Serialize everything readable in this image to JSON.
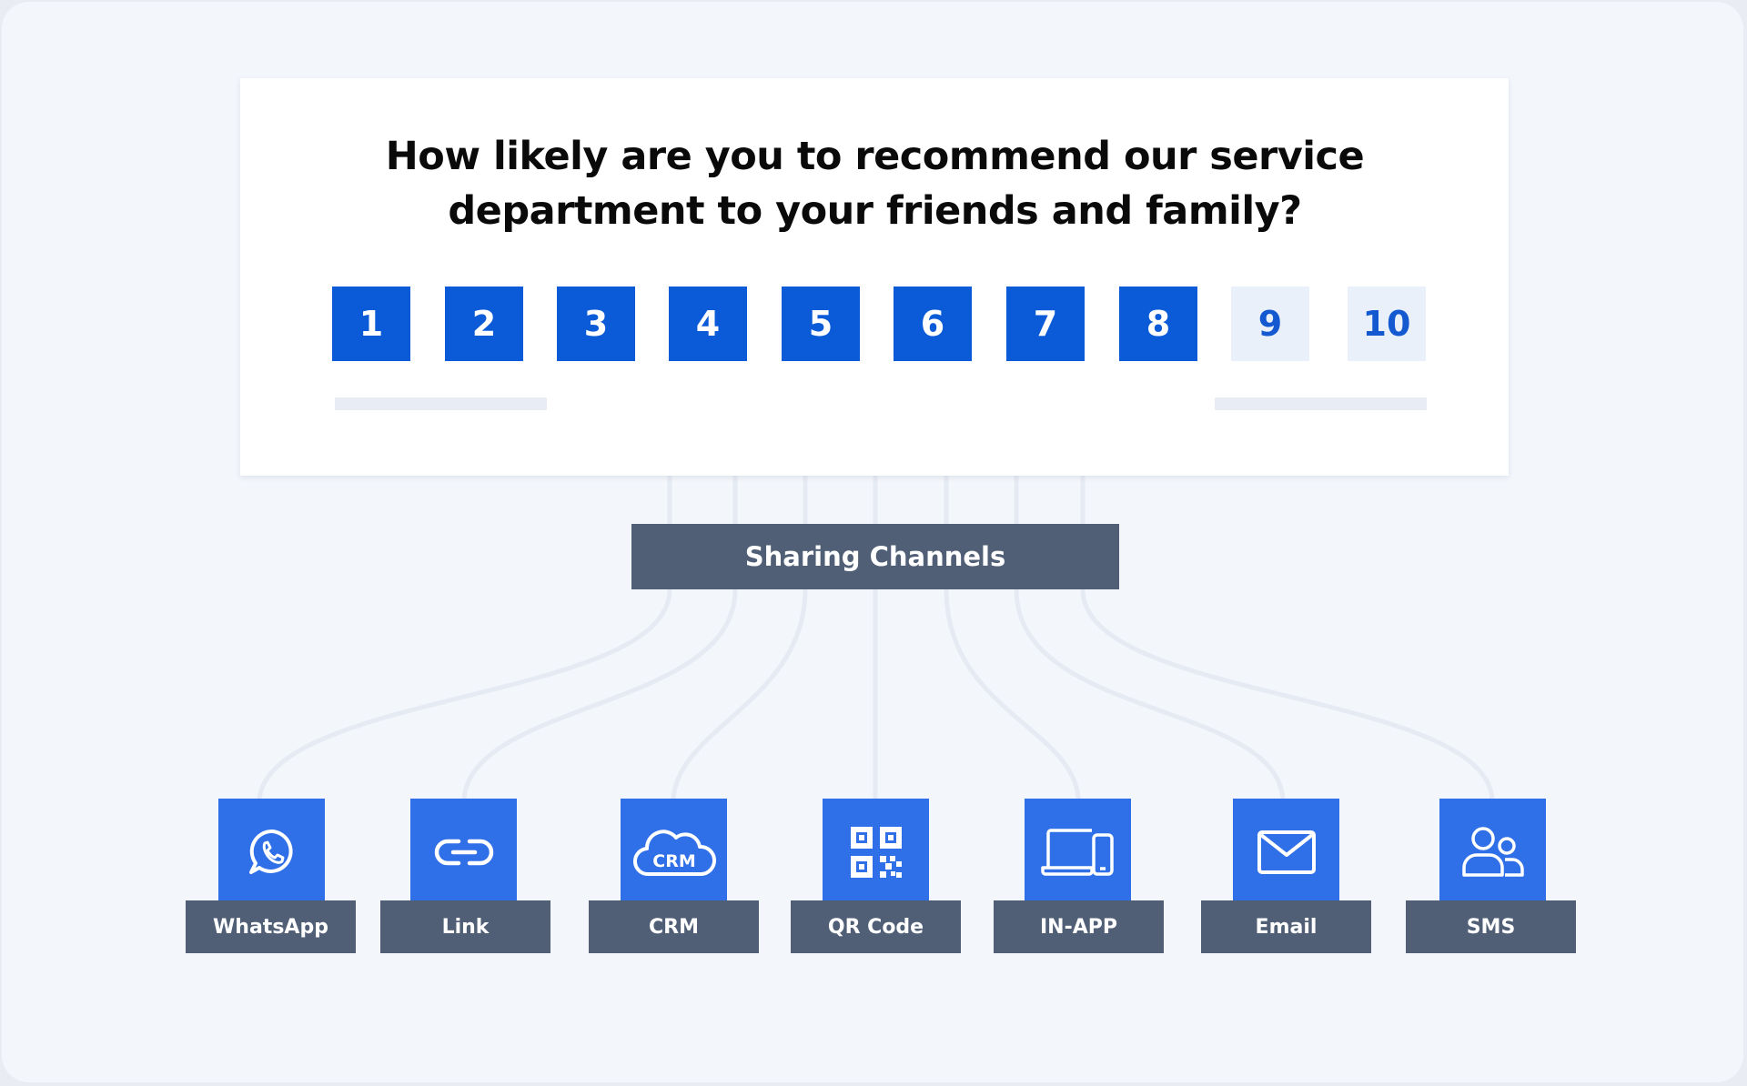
{
  "survey": {
    "question": "How likely are you to recommend our service department to your friends and family?",
    "scale": [
      "1",
      "2",
      "3",
      "4",
      "5",
      "6",
      "7",
      "8",
      "9",
      "10"
    ],
    "colors": {
      "selected": "#0b5bd8",
      "unselected": "#eaf0fa",
      "unselected_text": "#1559d0"
    }
  },
  "hub": {
    "label": "Sharing Channels",
    "color": "#505f76"
  },
  "channels": [
    {
      "label": "WhatsApp",
      "icon": "whatsapp-icon"
    },
    {
      "label": "Link",
      "icon": "link-icon"
    },
    {
      "label": "CRM",
      "icon": "crm-cloud-icon",
      "icon_text": "CRM"
    },
    {
      "label": "QR Code",
      "icon": "qr-code-icon"
    },
    {
      "label": "IN-APP",
      "icon": "laptop-phone-icon"
    },
    {
      "label": "Email",
      "icon": "envelope-icon"
    },
    {
      "label": "SMS",
      "icon": "users-icon"
    }
  ],
  "accent": "#2f6fe8"
}
